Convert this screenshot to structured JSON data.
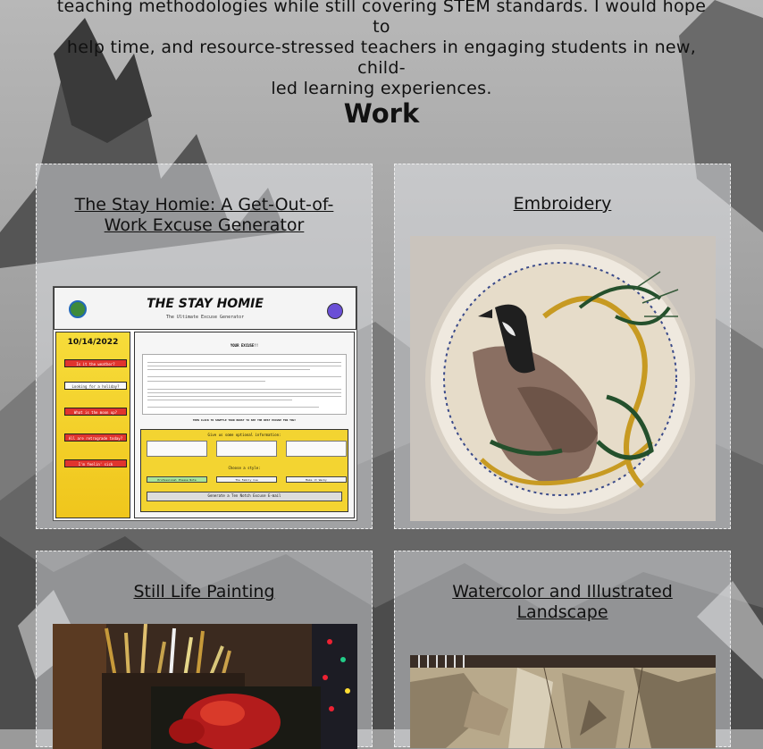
{
  "intro": {
    "lines": [
      "teaching methodologies while still covering STEM standards. I would hope to",
      "help time, and resource-stressed teachers in engaging students in new, child-",
      "led learning experiences."
    ]
  },
  "work": {
    "heading": "Work",
    "cards": [
      {
        "title_line1": "The Stay Homie: A Get-Out-of-",
        "title_line2": "Work Excuse Generator",
        "image": "app-screenshot"
      },
      {
        "title": "Embroidery",
        "image": "embroidered-goose"
      },
      {
        "title": "Still Life Painting",
        "image": "paint-brushes-still-life"
      },
      {
        "title_line1": "Watercolor and Illustrated",
        "title_line2": "Landscape",
        "image": "sketchbook-watercolor"
      }
    ]
  },
  "app_mock": {
    "title": "THE STAY HOMIE",
    "subtitle": "The Ultimate Excuse Generator",
    "date": "10/14/2022",
    "side_buttons": [
      "Is it the weather?",
      "Looking for a holiday?",
      "What is the moon up?",
      "All are retrograde today?",
      "I'm feelin' sick"
    ],
    "main_label": "YOUR EXCUSE!!",
    "prompt_label": "THEN CLICK TO SHUFFLE YOUR BOOST TO SEE THE BEST EXCUSE FOR YOU!",
    "optional_label": "Give us some optional information:",
    "style_label": "Choose a style:",
    "styles": [
      "Professional Please Note",
      "The Family Cue",
      "Make it Wacky"
    ],
    "generate": "Generate a Ten Notch Excuse E-mail"
  },
  "colors": {
    "accent_yellow": "#f3d431",
    "accent_red": "#e0342e",
    "card_border": "#efefef"
  }
}
